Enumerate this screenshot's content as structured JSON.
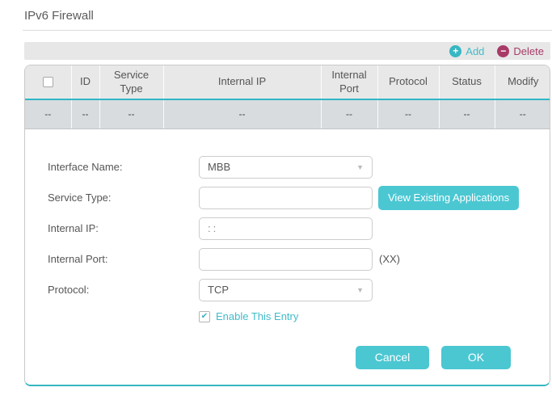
{
  "page": {
    "title": "IPv6 Firewall"
  },
  "toolbar": {
    "add_label": "Add",
    "delete_label": "Delete"
  },
  "icons": {
    "add": "+",
    "delete": "−",
    "check": "✔",
    "dropdown_arrow": "▼"
  },
  "table": {
    "headers": [
      "",
      "ID",
      "Service Type",
      "Internal IP",
      "Internal Port",
      "Protocol",
      "Status",
      "Modify"
    ],
    "rows": [
      [
        "--",
        "--",
        "--",
        "--",
        "--",
        "--",
        "--",
        "--"
      ]
    ]
  },
  "form": {
    "interface_name": {
      "label": "Interface Name:",
      "value": "MBB"
    },
    "service_type": {
      "label": "Service Type:",
      "value": "",
      "button_label": "View Existing Applications"
    },
    "internal_ip": {
      "label": "Internal IP:",
      "value": "::"
    },
    "internal_port": {
      "label": "Internal Port:",
      "value": "",
      "hint": "(XX)"
    },
    "protocol": {
      "label": "Protocol:",
      "value": "TCP"
    },
    "enable": {
      "label": "Enable This Entry",
      "checked": true
    },
    "buttons": {
      "cancel": "Cancel",
      "ok": "OK"
    }
  },
  "colors": {
    "accent_teal": "#4bc7d2",
    "teal_border": "#2fb7c7",
    "delete_magenta": "#a83a68",
    "header_bg": "#e8e8e8",
    "row_bg": "#d9dcde",
    "toolbar_bg": "#e7e7e7"
  }
}
